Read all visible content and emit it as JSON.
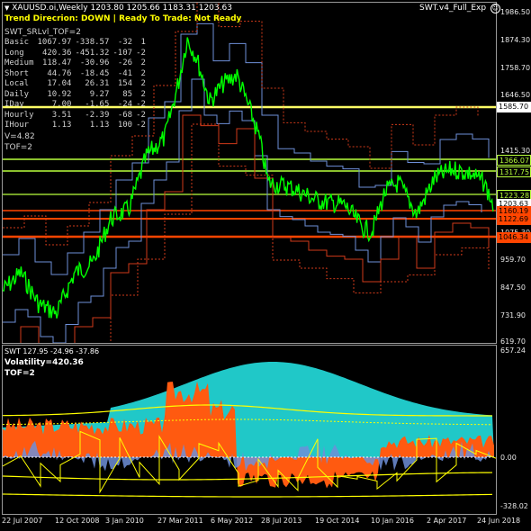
{
  "window": {
    "symbol_line": "XAUUSD.oi,Weekly  1203.80 1205.66 1183.31 1203.63",
    "ea_label": "SWT.v4_Full_Exp",
    "status_line": "Trend Direcrion:  DOWN   |   Ready To Trade:  Not Ready"
  },
  "info_panel": {
    "title": "SWT_SRLvl_TOF=2",
    "rows": [
      {
        "label": "Basic",
        "v1": "1067.97",
        "v2": "-338.57",
        "v3": "-32",
        "v4": "1"
      },
      {
        "label": "Long",
        "v1": "420.36",
        "v2": "-451.32",
        "v3": "-107",
        "v4": "-2"
      },
      {
        "label": "Medium",
        "v1": "118.47",
        "v2": "-30.96",
        "v3": "-26",
        "v4": "2"
      },
      {
        "label": "Short",
        "v1": "44.76",
        "v2": "-18.45",
        "v3": "-41",
        "v4": "2"
      },
      {
        "label": "Local",
        "v1": "17.04",
        "v2": "26.31",
        "v3": "154",
        "v4": "2"
      },
      {
        "label": "Daily",
        "v1": "10.92",
        "v2": "9.27",
        "v3": "85",
        "v4": "2"
      },
      {
        "label": "IDay",
        "v1": "7.00",
        "v2": "-1.65",
        "v3": "-24",
        "v4": "-2"
      },
      {
        "label": "Hourly",
        "v1": "3.51",
        "v2": "-2.39",
        "v3": "-68",
        "v4": "-2"
      },
      {
        "label": "IHour",
        "v1": "1.13",
        "v2": "1.13",
        "v3": "100",
        "v4": "-2"
      }
    ],
    "v_line": "V=4.82",
    "tof_line": "TOF=2"
  },
  "price_axis": {
    "labels": [
      "1986.50",
      "1874.30",
      "1758.70",
      "1646.50",
      "1415.30",
      "1075.30",
      "959.70",
      "847.50",
      "731.90",
      "619.70"
    ],
    "tags": [
      {
        "text": "1585.70",
        "bg": "#ffffff",
        "fg": "#000000"
      },
      {
        "text": "1366.07",
        "bg": "#000000",
        "fg": "#b8ff3c"
      },
      {
        "text": "1317.75",
        "bg": "#000000",
        "fg": "#b8ff3c"
      },
      {
        "text": "1223.28",
        "bg": "#000000",
        "fg": "#b8ff3c"
      },
      {
        "text": "1203.63",
        "bg": "#ffffff",
        "fg": "#000000"
      },
      {
        "text": "1160.19",
        "bg": "#ff4500",
        "fg": "#000000"
      },
      {
        "text": "1122.69",
        "bg": "#ff4500",
        "fg": "#000000"
      },
      {
        "text": "1046.34",
        "bg": "#ff4500",
        "fg": "#000000"
      }
    ]
  },
  "indicator": {
    "header": "SWT 127.95 -24.96 -37.86",
    "volatility": "Volatility=420.36",
    "tof": "TOF=2",
    "axis_labels": [
      "657.24",
      "0.00",
      "-328.02"
    ]
  },
  "time_axis": {
    "labels": [
      "22 Jul 2007",
      "12 Oct 2008",
      "3 Jan 2010",
      "27 Mar 2011",
      "6 May 2012",
      "28 Jul 2013",
      "19 Oct 2014",
      "10 Jan 2016",
      "2 Apr 2017",
      "24 Jun 2018"
    ]
  },
  "colors": {
    "price_line": "#00ff00",
    "support_line": "#ff4500",
    "resistance_line": "#b8ff3c",
    "band_blue": "#6e8fd8",
    "band_red": "#d03a1a",
    "volatility_fill": "#20c8c8",
    "osc_fill": "#ff5a10",
    "osc_blue": "#6e8fd8"
  },
  "icons": {
    "dropdown": "triangle-down-icon",
    "smiley": "smiley-face-icon"
  }
}
